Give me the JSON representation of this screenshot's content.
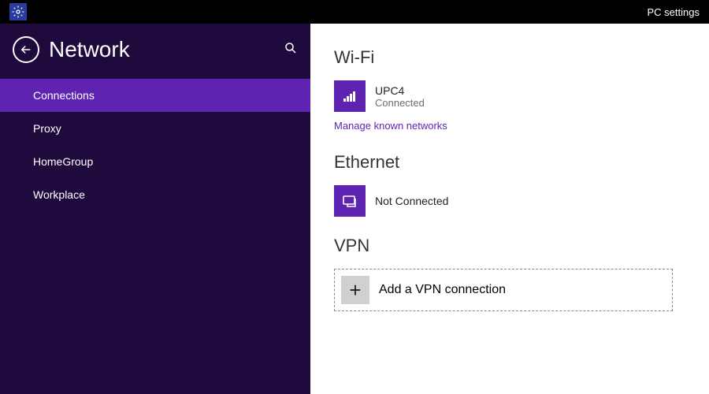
{
  "titlebar": {
    "label": "PC settings"
  },
  "sidebar": {
    "page_title": "Network",
    "items": [
      {
        "label": "Connections",
        "selected": true
      },
      {
        "label": "Proxy",
        "selected": false
      },
      {
        "label": "HomeGroup",
        "selected": false
      },
      {
        "label": "Workplace",
        "selected": false
      }
    ]
  },
  "main": {
    "wifi": {
      "heading": "Wi-Fi",
      "network_name": "UPC4",
      "network_status": "Connected",
      "manage_link": "Manage known networks"
    },
    "ethernet": {
      "heading": "Ethernet",
      "status": "Not Connected"
    },
    "vpn": {
      "heading": "VPN",
      "add_label": "Add a VPN connection"
    }
  },
  "colors": {
    "accent": "#5f23b2",
    "sidebar_bg": "#1e0a3c"
  }
}
